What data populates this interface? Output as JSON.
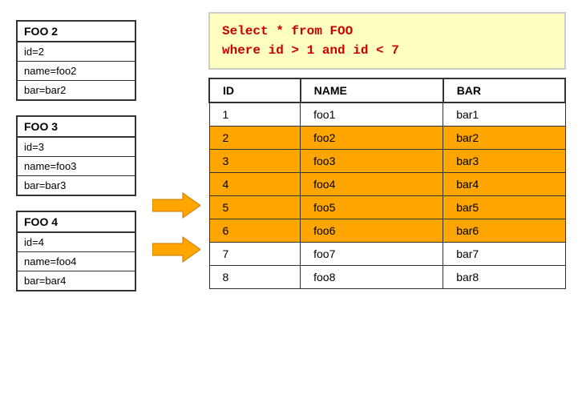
{
  "query": {
    "line1": "Select * from FOO",
    "line2": "where id > 1 and id < 7"
  },
  "foo_boxes": [
    {
      "title": "FOO 2",
      "rows": [
        "id=2",
        "name=foo2",
        "bar=bar2"
      ]
    },
    {
      "title": "FOO 3",
      "rows": [
        "id=3",
        "name=foo3",
        "bar=bar3"
      ]
    },
    {
      "title": "FOO 4",
      "rows": [
        "id=4",
        "name=foo4",
        "bar=bar4"
      ]
    }
  ],
  "table": {
    "headers": [
      "ID",
      "NAME",
      "BAR"
    ],
    "rows": [
      {
        "id": "1",
        "name": "foo1",
        "bar": "bar1",
        "highlight": false
      },
      {
        "id": "2",
        "name": "foo2",
        "bar": "bar2",
        "highlight": true
      },
      {
        "id": "3",
        "name": "foo3",
        "bar": "bar3",
        "highlight": true
      },
      {
        "id": "4",
        "name": "foo4",
        "bar": "bar4",
        "highlight": true
      },
      {
        "id": "5",
        "name": "foo5",
        "bar": "bar5",
        "highlight": true
      },
      {
        "id": "6",
        "name": "foo6",
        "bar": "bar6",
        "highlight": true
      },
      {
        "id": "7",
        "name": "foo7",
        "bar": "bar7",
        "highlight": false
      },
      {
        "id": "8",
        "name": "foo8",
        "bar": "bar8",
        "highlight": false
      }
    ]
  },
  "arrows": [
    "arrow1",
    "arrow2"
  ]
}
